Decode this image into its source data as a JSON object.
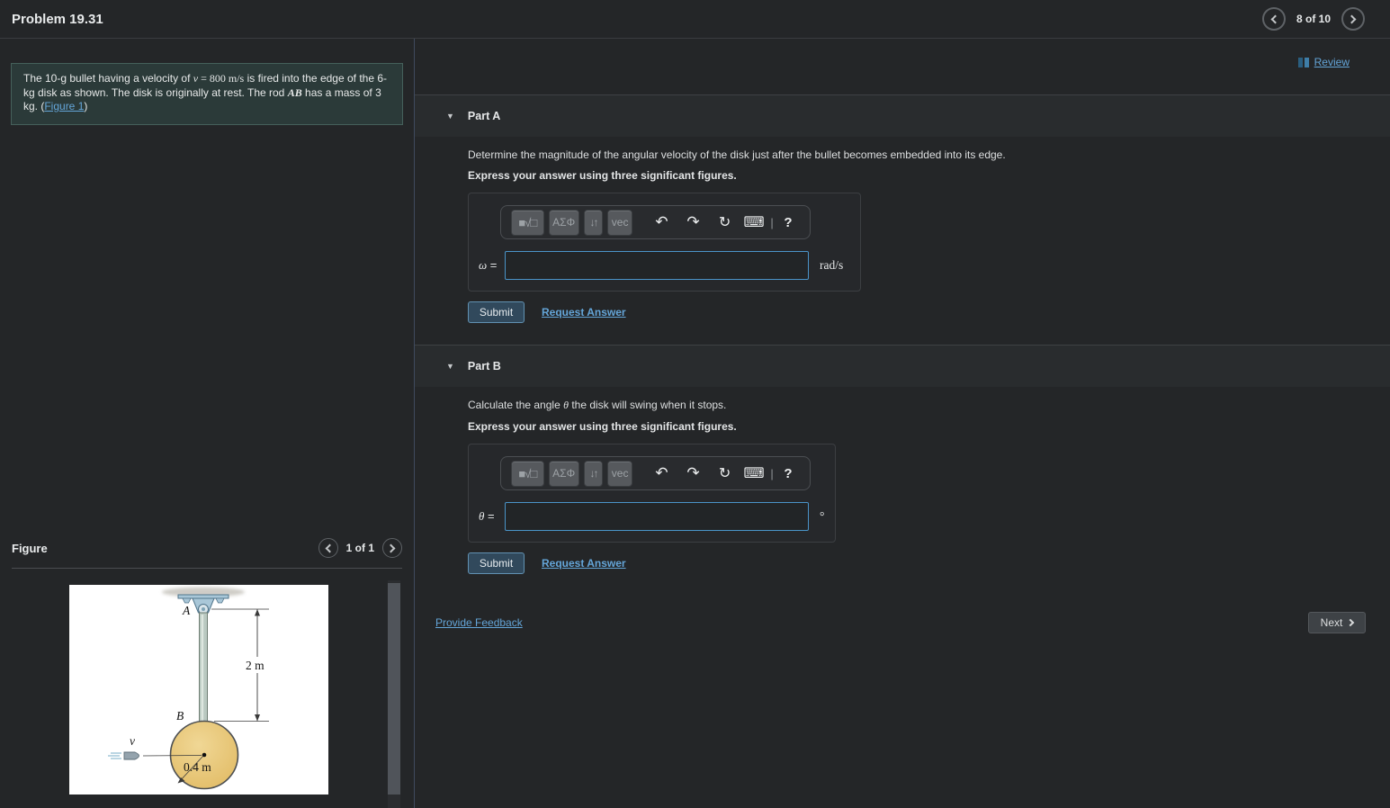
{
  "header": {
    "title": "Problem 19.31",
    "pagination": "8 of 10"
  },
  "review": {
    "label": "Review"
  },
  "problem": {
    "seg1": "The 10-g bullet having a velocity of ",
    "v_sym": "v",
    "seg2": " = 800 ",
    "v_unit": "m/s",
    "seg3": " is fired into the edge of the 6-kg disk as shown. The disk is originally at rest. The rod ",
    "rod_sym": "AB",
    "seg4": " has a mass of 3 kg. (",
    "figure_link": "Figure 1",
    "seg5": ")"
  },
  "toolbar": {
    "template_icon": "■√□",
    "greek": "ΑΣΦ",
    "updown": "↓↑",
    "vec": "vec",
    "undo_icon": "↶",
    "redo_icon": "↷",
    "reset_icon": "↻",
    "keyboard_icon": "⌨",
    "separator": "|",
    "help": "?"
  },
  "part_a": {
    "collapse_icon": "▼",
    "title": "Part A",
    "description": "Determine the magnitude of the angular velocity of the disk just after the bullet becomes embedded into its edge.",
    "instruction": "Express your answer using three significant figures.",
    "var_symbol": "ω",
    "equals": " =",
    "input_value": "",
    "unit": "rad/s",
    "submit_label": "Submit",
    "request_answer_label": "Request Answer"
  },
  "part_b": {
    "collapse_icon": "▼",
    "title": "Part B",
    "desc_seg1": "Calculate the angle ",
    "theta_sym": "θ",
    "desc_seg2": " the disk will swing when it stops.",
    "instruction": "Express your answer using three significant figures.",
    "var_symbol": "θ",
    "equals": " =",
    "input_value": "",
    "unit": "°",
    "submit_label": "Submit",
    "request_answer_label": "Request Answer"
  },
  "figure_panel": {
    "title": "Figure",
    "pagination": "1 of 1",
    "labels": {
      "pin": "A",
      "joint": "B",
      "velocity": "v",
      "rod_length": "2 m",
      "disk_radius": "0.4 m"
    }
  },
  "footer": {
    "provide_feedback": "Provide Feedback",
    "next_label": "Next"
  },
  "colors": {
    "link_blue": "#64a5d8",
    "input_border_blue": "#4a94c8",
    "submit_bg": "#31495c",
    "problem_box_bg": "#2b3a39",
    "disk_fill": "#e7c478",
    "panel_bg": "#242628"
  }
}
